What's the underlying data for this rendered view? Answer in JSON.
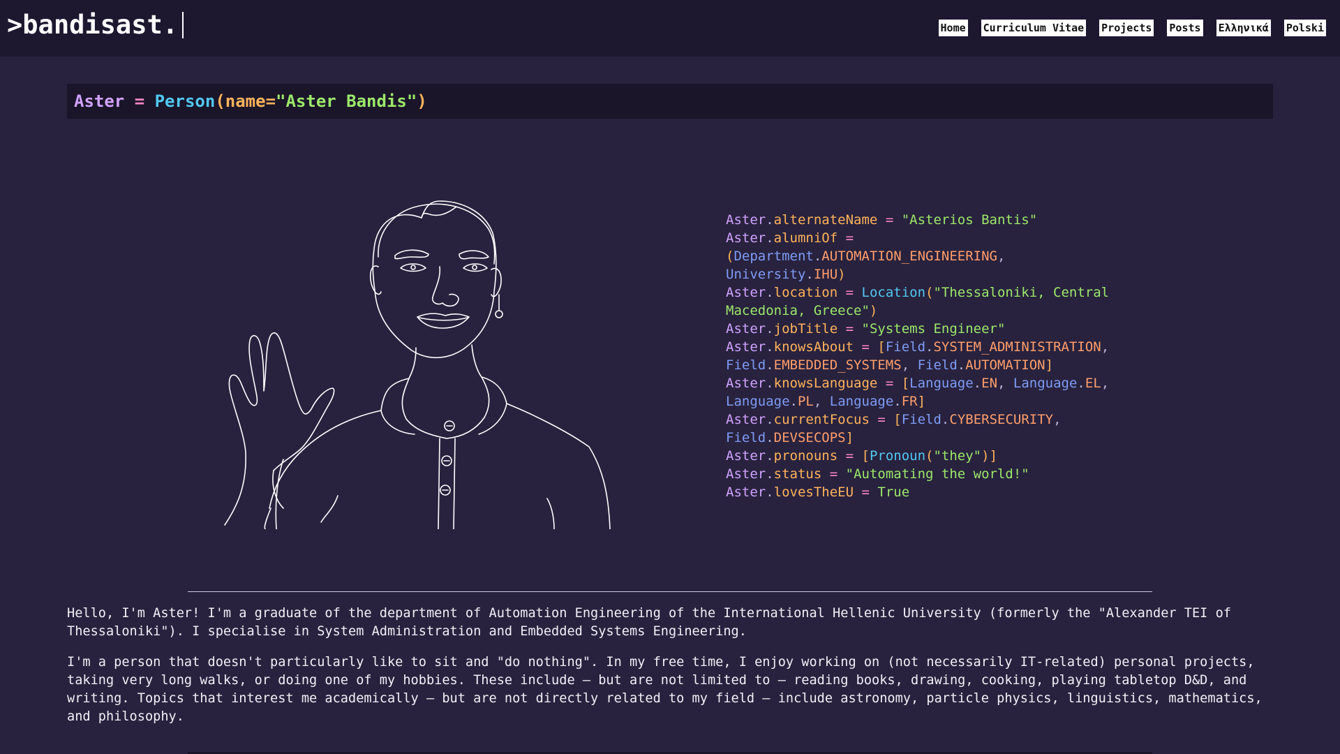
{
  "header": {
    "brand": ">bandisast.",
    "nav": [
      "Home",
      "Curriculum Vitae",
      "Projects",
      "Posts",
      "Ελληνικά",
      "Polski"
    ]
  },
  "headline": {
    "var": "Aster",
    "op": " = ",
    "cls": "Person",
    "open": "(",
    "kw": "name=",
    "str": "\"Aster Bandis\"",
    "close": ")"
  },
  "code": {
    "l1": {
      "obj": "Aster",
      "attr": "alternateName",
      "eq": " = ",
      "val": "\"Asterios Bantis\""
    },
    "l2": {
      "obj": "Aster",
      "attr": "alumniOf",
      "eq": " = ",
      "p1": "(",
      "ns1": "Department",
      "e1": "AUTOMATION_ENGINEERING",
      "sep": ", ",
      "ns2": "University",
      "e2": "IHU",
      "p2": ")"
    },
    "l3": {
      "obj": "Aster",
      "attr": "location",
      "eq": " = ",
      "cls": "Location",
      "p1": "(",
      "val": "\"Thessaloniki, Central Macedonia, Greece\"",
      "p2": ")"
    },
    "l4": {
      "obj": "Aster",
      "attr": "jobTitle",
      "eq": " = ",
      "val": "\"Systems Engineer\""
    },
    "l5": {
      "obj": "Aster",
      "attr": "knowsAbout",
      "eq": " = ",
      "b1": "[",
      "ns1": "Field",
      "e1": "SYSTEM_ADMINISTRATION",
      "s1": ", ",
      "ns2": "Field",
      "e2": "EMBEDDED_SYSTEMS",
      "s2": ", ",
      "ns3": "Field",
      "e3": "AUTOMATION",
      "b2": "]"
    },
    "l6": {
      "obj": "Aster",
      "attr": "knowsLanguage",
      "eq": " = ",
      "b1": "[",
      "ns1": "Language",
      "e1": "EN",
      "s1": ", ",
      "ns2": "Language",
      "e2": "EL",
      "s2": ", ",
      "ns3": "Language",
      "e3": "PL",
      "s3": ", ",
      "ns4": "Language",
      "e4": "FR",
      "b2": "]"
    },
    "l7": {
      "obj": "Aster",
      "attr": "currentFocus",
      "eq": " = ",
      "b1": "[",
      "ns1": "Field",
      "e1": "CYBERSECURITY",
      "s1": ", ",
      "ns2": "Field",
      "e2": "DEVSECOPS",
      "b2": "]"
    },
    "l8": {
      "obj": "Aster",
      "attr": "pronouns",
      "eq": " = ",
      "b1": "[",
      "cls": "Pronoun",
      "p1": "(",
      "val": "\"they\"",
      "p2": ")",
      "b2": "]"
    },
    "l9": {
      "obj": "Aster",
      "attr": "status",
      "eq": " = ",
      "val": "\"Automating the world!\""
    },
    "l10": {
      "obj": "Aster",
      "attr": "lovesTheEU",
      "eq": " = ",
      "val": "True"
    },
    "dot": "."
  },
  "about": {
    "p1": "Hello, I'm Aster! I'm a graduate of the department of Automation Engineering of the International Hellenic University (formerly the \"Alexander TEI of Thessaloniki\"). I specialise in System Administration and Embedded Systems Engineering.",
    "p2": "I'm a person that doesn't particularly like to sit and \"do nothing\". In my free time, I enjoy working on (not necessarily IT-related) personal projects, taking very long walks, or doing one of my hobbies. These include — but are not limited to — reading books, drawing, cooking, playing tabletop D&D, and writing. Topics that interest me academically — but are not directly related to my field — include astronomy, particle physics, linguistics, mathematics, and philosophy."
  },
  "colors": {
    "background": "#28223e",
    "header": "#1d1830",
    "codeblock": "#1a1529",
    "variable": "#d2a2ff",
    "operator": "#ff86c6",
    "class": "#52c8f0",
    "attribute": "#ffb35c",
    "string": "#9de86a",
    "enum": "#ff9e6b",
    "namespace": "#7f9cf5"
  },
  "icons": {
    "portrait": "line-drawing-portrait-waving"
  }
}
